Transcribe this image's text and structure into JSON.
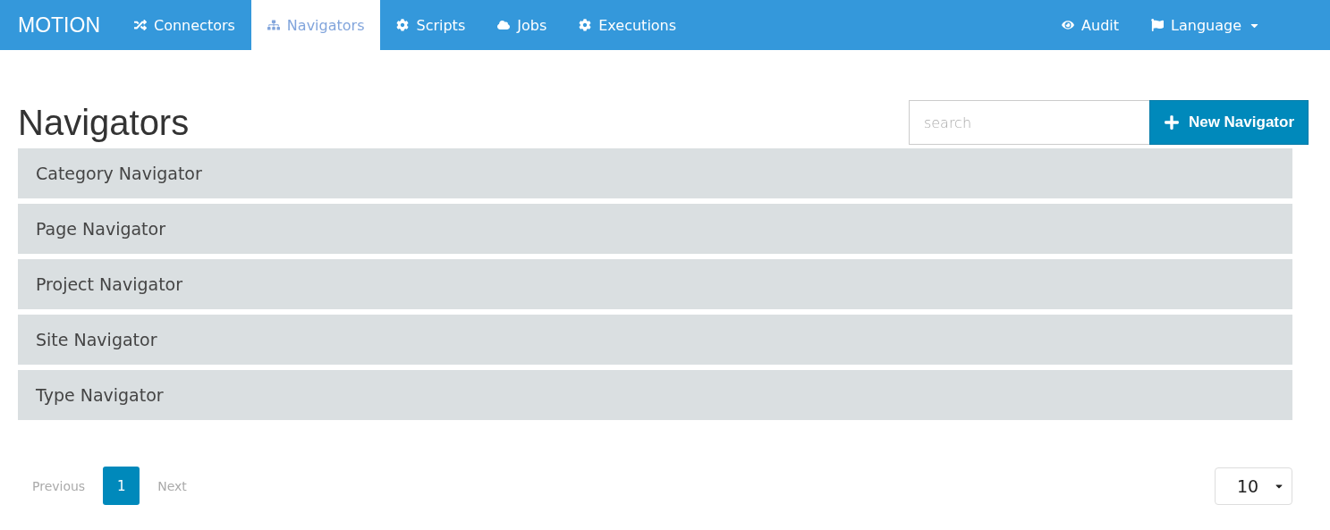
{
  "navbar": {
    "brand": "MOTION",
    "items": [
      {
        "label": "Connectors",
        "selected": false
      },
      {
        "label": "Navigators",
        "selected": true
      },
      {
        "label": "Scripts",
        "selected": false
      },
      {
        "label": "Jobs",
        "selected": false
      },
      {
        "label": "Executions",
        "selected": false
      }
    ],
    "right_items": [
      {
        "label": "Audit",
        "dropdown": false
      },
      {
        "label": "Language",
        "dropdown": true
      }
    ]
  },
  "page": {
    "title": "Navigators",
    "search": {
      "placeholder": "search"
    },
    "new_button": "New Navigator"
  },
  "list": [
    {
      "label": "Category Navigator"
    },
    {
      "label": "Page Navigator"
    },
    {
      "label": "Project Navigator"
    },
    {
      "label": "Site Navigator"
    },
    {
      "label": "Type Navigator"
    }
  ],
  "pagination": {
    "previous": {
      "label": "Previous",
      "disabled": true
    },
    "pages": [
      {
        "label": "1",
        "selected": true
      }
    ],
    "next": {
      "label": "Next",
      "disabled": true
    },
    "page_size": "10"
  }
}
